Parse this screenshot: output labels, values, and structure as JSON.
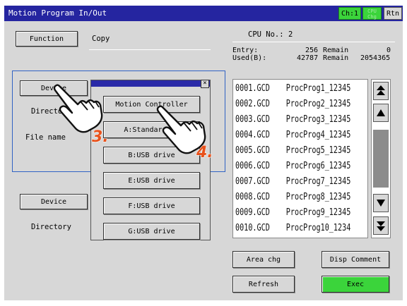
{
  "header": {
    "title": "Motion Program In/Out",
    "ch_label": "Ch:1",
    "cpu_chg_label": "CPU Chg",
    "rtn_label": "Rtn"
  },
  "function_row": {
    "button_label": "Function",
    "value": "Copy"
  },
  "cpu": {
    "label": "CPU No.:",
    "value": "2"
  },
  "stats": {
    "entry_label": "Entry:",
    "entry_value": "256",
    "entry_remain_label": "Remain",
    "entry_remain_value": "0",
    "used_label": "Used(B):",
    "used_value": "42787",
    "used_remain_label": "Remain",
    "used_remain_value": "2054365"
  },
  "source": {
    "device_button": "Device",
    "directory_label": "Director",
    "filename_label": "File name"
  },
  "destination": {
    "device_button": "Device",
    "directory_label": "Directory"
  },
  "popup": {
    "close_label": "×",
    "options": [
      "Motion Controller",
      "A:Standard SD",
      "B:USB drive",
      "E:USB drive",
      "F:USB drive",
      "G:USB drive"
    ]
  },
  "files": [
    {
      "name": "0001.GCD",
      "comment": "ProcProg1_12345"
    },
    {
      "name": "0002.GCD",
      "comment": "ProcProg2_12345"
    },
    {
      "name": "0003.GCD",
      "comment": "ProcProg3_12345"
    },
    {
      "name": "0004.GCD",
      "comment": "ProcProg4_12345"
    },
    {
      "name": "0005.GCD",
      "comment": "ProcProg5_12345"
    },
    {
      "name": "0006.GCD",
      "comment": "ProcProg6_12345"
    },
    {
      "name": "0007.GCD",
      "comment": "ProcProg7_12345"
    },
    {
      "name": "0008.GCD",
      "comment": "ProcProg8_12345"
    },
    {
      "name": "0009.GCD",
      "comment": "ProcProg9_12345"
    },
    {
      "name": "0010.GCD",
      "comment": "ProcProg10_1234"
    }
  ],
  "scrollbar": {
    "page_up_icon": "double-up-arrow-icon",
    "line_up_icon": "up-arrow-icon",
    "line_down_icon": "down-arrow-icon",
    "page_down_icon": "double-down-arrow-icon"
  },
  "actions": {
    "area_chg": "Area chg",
    "disp_comment": "Disp Comment",
    "refresh": "Refresh",
    "exec": "Exec"
  },
  "callouts": {
    "step3": "3.",
    "step4": "4."
  },
  "colors": {
    "title_bar": "#2525a0",
    "panel_bg": "#d7d7d7",
    "accent_green": "#3bd43b",
    "callout_orange": "#e8521c",
    "group_border": "#3062c4"
  }
}
